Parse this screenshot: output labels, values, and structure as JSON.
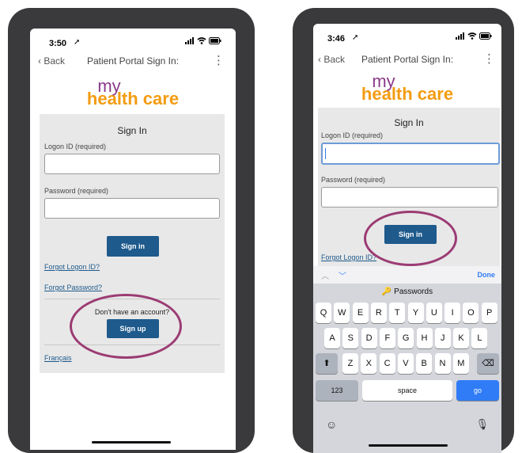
{
  "left_phone": {
    "status_time": "3:50",
    "nav": {
      "back_label": "Back",
      "title": "Patient Portal Sign In:",
      "menu_icon": "kebab-icon"
    },
    "logo": {
      "line1": "my",
      "line2": "health care"
    },
    "form": {
      "heading": "Sign In",
      "logon_label": "Logon ID (required)",
      "logon_value": "",
      "password_label": "Password (required)",
      "password_value": "",
      "signin_button": "Sign in",
      "forgot_logon": "Forgot Logon ID?",
      "forgot_password": "Forgot Password?",
      "no_account": "Don't have an account?",
      "signup_button": "Sign up",
      "language_link": "Français"
    }
  },
  "right_phone": {
    "status_time": "3:46",
    "nav": {
      "back_label": "Back",
      "title": "Patient Portal Sign In:",
      "menu_icon": "kebab-icon"
    },
    "logo": {
      "line1": "my",
      "line2": "health care"
    },
    "form": {
      "heading": "Sign In",
      "logon_label": "Logon ID (required)",
      "logon_value": "",
      "password_label": "Password (required)",
      "password_value": "",
      "signin_button": "Sign in",
      "forgot_logon": "Forgot Logon ID?"
    },
    "keyboard": {
      "done_label": "Done",
      "passwords_label": "Passwords",
      "row1": [
        "Q",
        "W",
        "E",
        "R",
        "T",
        "Y",
        "U",
        "I",
        "O",
        "P"
      ],
      "row2": [
        "A",
        "S",
        "D",
        "F",
        "G",
        "H",
        "J",
        "K",
        "L"
      ],
      "row3": [
        "Z",
        "X",
        "C",
        "V",
        "B",
        "N",
        "M"
      ],
      "numbers_key": "123",
      "space_key": "space",
      "go_key": "go"
    }
  },
  "colors": {
    "phone_frame": "#3a3a3c",
    "brand_purple": "#8a3a8a",
    "brand_orange": "#f39c12",
    "button_blue": "#1e5a8c",
    "highlight_ring": "#9b3b73"
  }
}
